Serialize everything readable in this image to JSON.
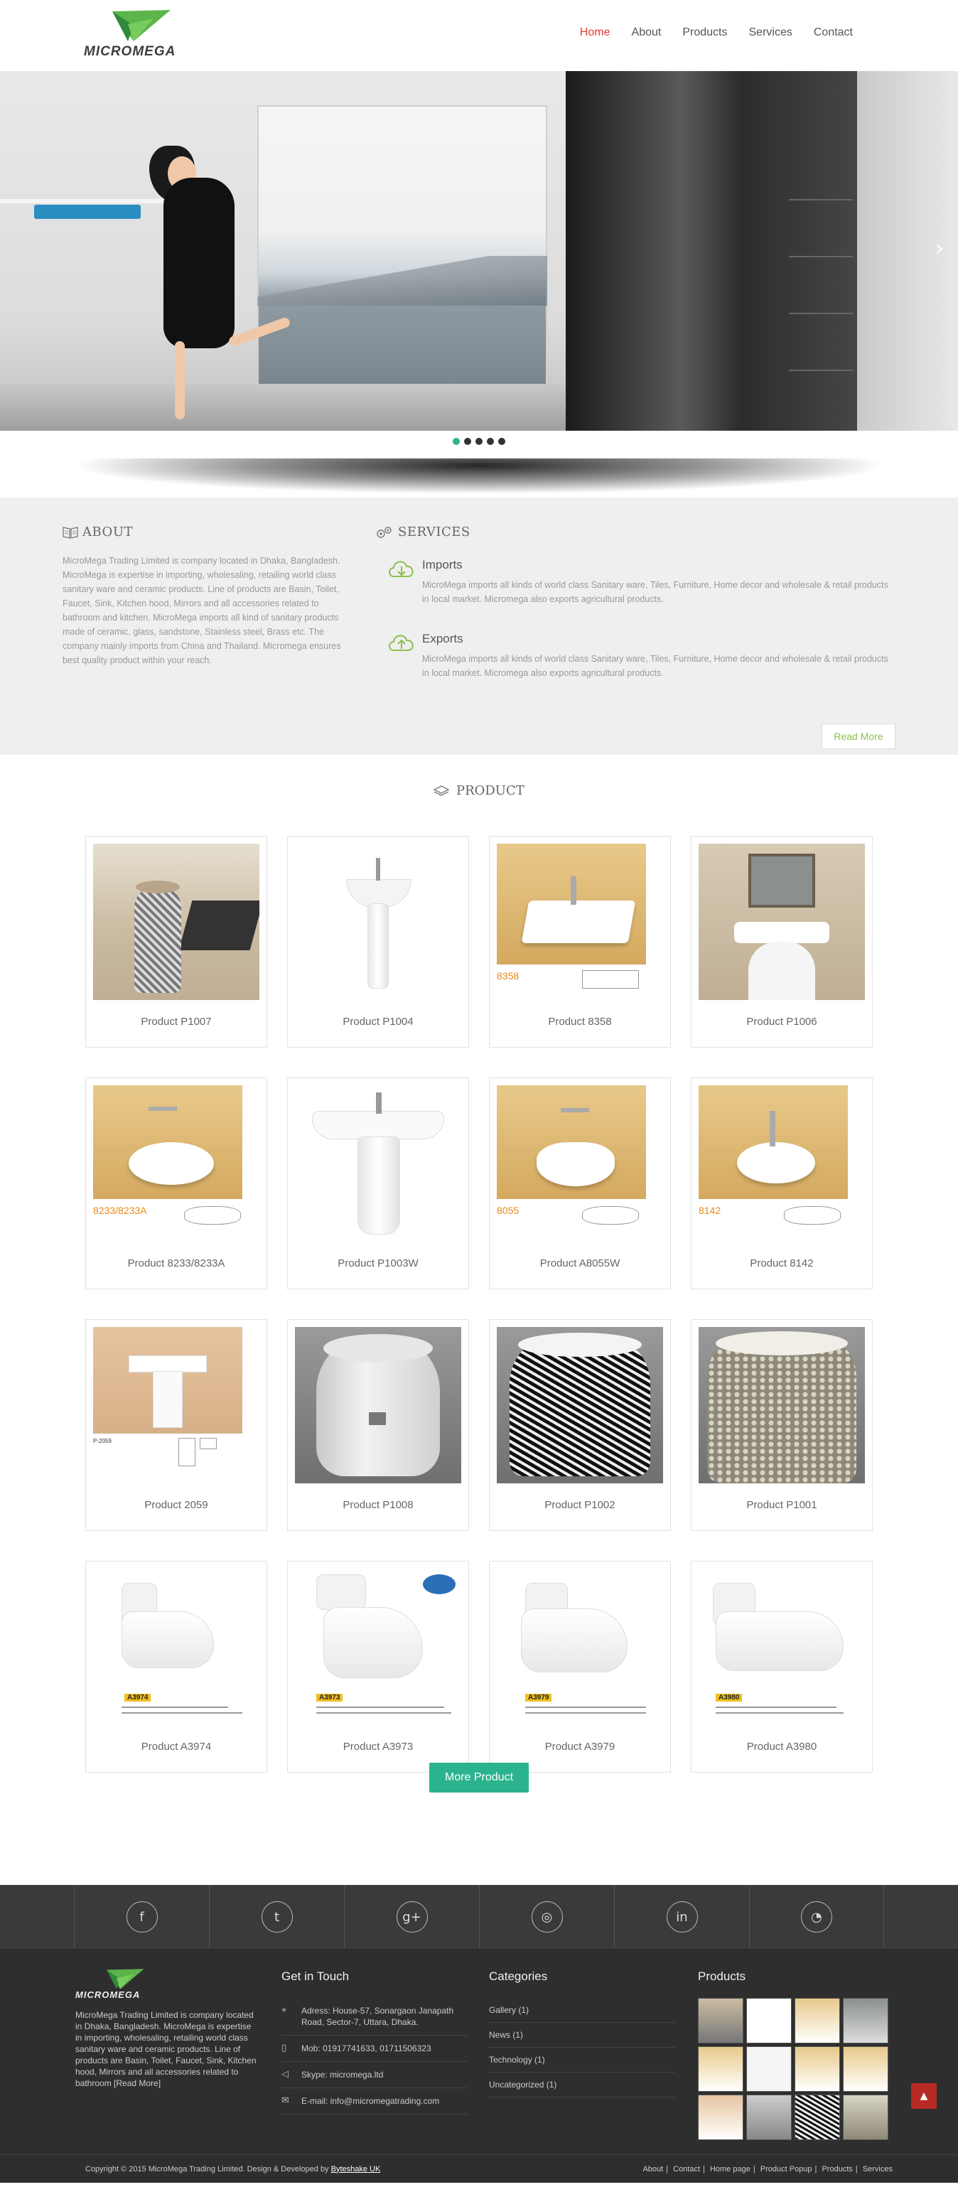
{
  "brand": {
    "name": "MICROMEGA",
    "accent": "#2bb38d",
    "nav_active": "#e53b2c",
    "logo_green": "#5cb54a"
  },
  "nav": {
    "items": [
      {
        "label": "Home",
        "active": true
      },
      {
        "label": "About",
        "active": false
      },
      {
        "label": "Products",
        "active": false
      },
      {
        "label": "Services",
        "active": false
      },
      {
        "label": "Contact",
        "active": false
      }
    ]
  },
  "slider": {
    "next_icon": "chevron-right-icon",
    "slides": 5,
    "active_slide": 1
  },
  "about": {
    "title": "ABOUT",
    "body": "MicroMega Trading Limited is company located in Dhaka, Bangladesh. MicroMega is expertise in importing, wholesaling, retailing world class sanitary ware and ceramic products. Line of products are Basin, Toilet, Faucet, Sink, Kitchen hood, Mirrors and all accessories related to bathroom and kitchen. MicroMega imports all kind of sanitary products made of ceramic, glass, sandstone, Stainless steel, Brass etc. The company mainly imports from China and Thailand. Micromega ensures best quality product within your reach."
  },
  "services": {
    "title": "SERVICES",
    "items": [
      {
        "title": "Imports",
        "icon": "cloud-download-icon",
        "body": "MicroMega imports all kinds of world class Sanitary ware, Tiles, Furniture, Home decor and wholesale & retail products in local market. Micromega also exports agricultural products."
      },
      {
        "title": "Exports",
        "icon": "cloud-upload-icon",
        "body": "MicroMega imports all kinds of world class Sanitary ware, Tiles, Furniture, Home decor and wholesale & retail products in local market. Micromega also exports agricultural products."
      }
    ],
    "read_more": "Read More"
  },
  "products": {
    "title": "PRODUCT",
    "items": [
      {
        "name": "Product P1007"
      },
      {
        "name": "Product P1004"
      },
      {
        "name": "Product 8358",
        "code": "8358"
      },
      {
        "name": "Product P1006"
      },
      {
        "name": "Product 8233/8233A",
        "code": "8233/8233A"
      },
      {
        "name": "Product P1003W"
      },
      {
        "name": "Product A8055W",
        "code": "8055"
      },
      {
        "name": "Product 8142",
        "code": "8142"
      },
      {
        "name": "Product 2059",
        "code": "P-2059"
      },
      {
        "name": "Product P1008"
      },
      {
        "name": "Product P1002"
      },
      {
        "name": "Product P1001"
      },
      {
        "name": "Product A3974",
        "code": "A3974"
      },
      {
        "name": "Product A3973",
        "code": "A3973"
      },
      {
        "name": "Product A3979",
        "code": "A3979"
      },
      {
        "name": "Product A3980",
        "code": "A3980"
      }
    ],
    "more_label": "More Product"
  },
  "social": [
    {
      "icon": "facebook-icon",
      "glyph": "f"
    },
    {
      "icon": "twitter-icon",
      "glyph": "t"
    },
    {
      "icon": "google-plus-icon",
      "glyph": "g+"
    },
    {
      "icon": "dribbble-icon",
      "glyph": "◎"
    },
    {
      "icon": "linkedin-icon",
      "glyph": "in"
    },
    {
      "icon": "rss-icon",
      "glyph": "◔"
    }
  ],
  "footer": {
    "about_text": "MicroMega Trading Limited is company located in Dhaka, Bangladesh. MicroMega is expertise in importing, wholesaling, retailing world class sanitary ware and ceramic products. Line of products are Basin, Toilet, Faucet, Sink, Kitchen hood, Mirrors and all accessories related to bathroom [Read More]",
    "contact": {
      "title": "Get in Touch",
      "address": "Adress: House-57, Sonargaon Janapath Road, Sector-7, Uttara, Dhaka.",
      "mobile": "Mob: 01917741633, 01711506323",
      "skype": "Skype: micromega.ltd",
      "email": "E-mail: info@micromegatrading.com"
    },
    "categories": {
      "title": "Categories",
      "items": [
        "Gallery (1)",
        "News (1)",
        "Technology (1)",
        "Uncategorized (1)"
      ]
    },
    "products_title": "Products",
    "copyright": "Copyright © 2015 MicroMega Trading Limited. Design & Developed by",
    "developer": "Byteshake UK",
    "links": [
      "About",
      "Contact",
      "Home page",
      "Product Popup",
      "Products",
      "Services"
    ],
    "to_top_icon": "arrow-up-icon"
  }
}
